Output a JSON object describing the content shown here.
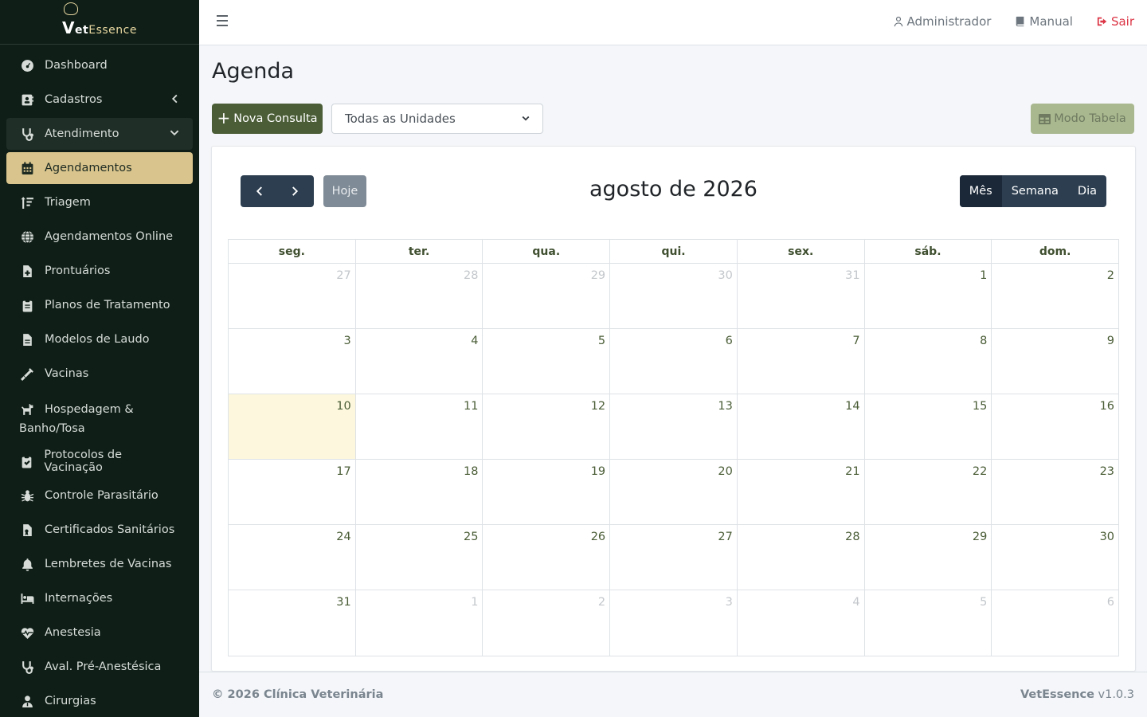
{
  "brand": {
    "logo_v": "V",
    "logo_et": "et",
    "logo_rest": "Essence"
  },
  "sidebar": {
    "items": [
      {
        "label": "Dashboard",
        "icon": "gauge-icon"
      },
      {
        "label": "Cadastros",
        "icon": "address-card-icon"
      },
      {
        "label": "Atendimento",
        "icon": "stethoscope-icon"
      },
      {
        "label": "Agendamentos",
        "icon": "calendar-icon"
      },
      {
        "label": "Triagem",
        "icon": "sort-icon"
      },
      {
        "label": "Agendamentos Online",
        "icon": "globe-icon"
      },
      {
        "label": "Prontuários",
        "icon": "file-medical-icon"
      },
      {
        "label": "Planos de Tratamento",
        "icon": "clipboard-icon"
      },
      {
        "label": "Modelos de Laudo",
        "icon": "file-lines-icon"
      },
      {
        "label": "Vacinas",
        "icon": "syringe-icon"
      },
      {
        "label_1": "Hospedagem &",
        "label_2": "Banho/Tosa",
        "icon": "dog-icon"
      },
      {
        "label": "Protocolos de Vacinação",
        "icon": "clipboard-check-icon"
      },
      {
        "label": "Controle Parasitário",
        "icon": "bug-icon"
      },
      {
        "label": "Certificados Sanitários",
        "icon": "file-certificate-icon"
      },
      {
        "label": "Lembretes de Vacinas",
        "icon": "bell-icon"
      },
      {
        "label": "Internações",
        "icon": "bed-icon"
      },
      {
        "label": "Anestesia",
        "icon": "heart-pulse-icon"
      },
      {
        "label": "Aval. Pré-Anestésica",
        "icon": "stethoscope-icon"
      },
      {
        "label": "Cirurgias",
        "icon": "user-doctor-icon"
      }
    ]
  },
  "topbar": {
    "user": "Administrador",
    "manual": "Manual",
    "logout": "Sair"
  },
  "page": {
    "title": "Agenda",
    "new_button": "Nova Consulta",
    "unit_select": "Todas as Unidades",
    "table_mode": "Modo Tabela"
  },
  "calendar": {
    "today_label": "Hoje",
    "title": "agosto de 2026",
    "views": [
      "Mês",
      "Semana",
      "Dia"
    ],
    "active_view": "Mês",
    "weekdays": [
      "seg.",
      "ter.",
      "qua.",
      "qui.",
      "sex.",
      "sáb.",
      "dom."
    ],
    "weeks": [
      [
        [
          "27",
          true
        ],
        [
          "28",
          true
        ],
        [
          "29",
          true
        ],
        [
          "30",
          true
        ],
        [
          "31",
          true
        ],
        [
          "1",
          false
        ],
        [
          "2",
          false
        ]
      ],
      [
        [
          "3",
          false
        ],
        [
          "4",
          false
        ],
        [
          "5",
          false
        ],
        [
          "6",
          false
        ],
        [
          "7",
          false
        ],
        [
          "8",
          false
        ],
        [
          "9",
          false
        ]
      ],
      [
        [
          "10",
          false
        ],
        [
          "11",
          false
        ],
        [
          "12",
          false
        ],
        [
          "13",
          false
        ],
        [
          "14",
          false
        ],
        [
          "15",
          false
        ],
        [
          "16",
          false
        ]
      ],
      [
        [
          "17",
          false
        ],
        [
          "18",
          false
        ],
        [
          "19",
          false
        ],
        [
          "20",
          false
        ],
        [
          "21",
          false
        ],
        [
          "22",
          false
        ],
        [
          "23",
          false
        ]
      ],
      [
        [
          "24",
          false
        ],
        [
          "25",
          false
        ],
        [
          "26",
          false
        ],
        [
          "27",
          false
        ],
        [
          "28",
          false
        ],
        [
          "29",
          false
        ],
        [
          "30",
          false
        ]
      ],
      [
        [
          "31",
          false
        ],
        [
          "1",
          true
        ],
        [
          "2",
          true
        ],
        [
          "3",
          true
        ],
        [
          "4",
          true
        ],
        [
          "5",
          true
        ],
        [
          "6",
          true
        ]
      ]
    ],
    "today_day": "10",
    "today_color": "#fdf8dd"
  },
  "footer": {
    "copyright": "© 2026 Clínica Veterinária",
    "app_name": "VetEssence",
    "version": "v1.0.3"
  },
  "colors": {
    "sidebar_bg": "#0f1f17",
    "active_item": "#d8c48c",
    "primary_button": "#4a5d36",
    "logout": "#dc3545"
  }
}
